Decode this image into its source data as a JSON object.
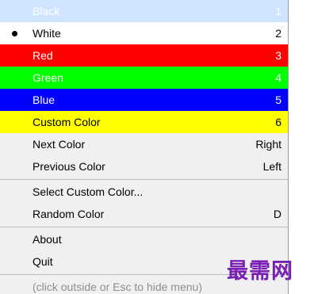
{
  "menu": {
    "colors": [
      {
        "label": "Black",
        "shortcut": "1",
        "bg": "#cfe4ff",
        "fg": "#ffffff"
      },
      {
        "label": "White",
        "shortcut": "2",
        "bg": "#ffffff",
        "fg": "#000000",
        "selected": true
      },
      {
        "label": "Red",
        "shortcut": "3",
        "bg": "#ff0000",
        "fg": "#ffffff"
      },
      {
        "label": "Green",
        "shortcut": "4",
        "bg": "#00ff00",
        "fg": "#ffffff"
      },
      {
        "label": "Blue",
        "shortcut": "5",
        "bg": "#0000ff",
        "fg": "#ffffff"
      },
      {
        "label": "Custom Color",
        "shortcut": "6",
        "bg": "#ffff00",
        "fg": "#000000"
      }
    ],
    "next_color": {
      "label": "Next Color",
      "shortcut": "Right"
    },
    "previous_color": {
      "label": "Previous Color",
      "shortcut": "Left"
    },
    "select_custom_color": {
      "label": "Select Custom Color..."
    },
    "random_color": {
      "label": "Random Color",
      "shortcut": "D"
    },
    "about": {
      "label": "About"
    },
    "quit": {
      "label": "Quit"
    },
    "hint": "(click outside or Esc to hide menu)"
  },
  "watermark": "最需网"
}
